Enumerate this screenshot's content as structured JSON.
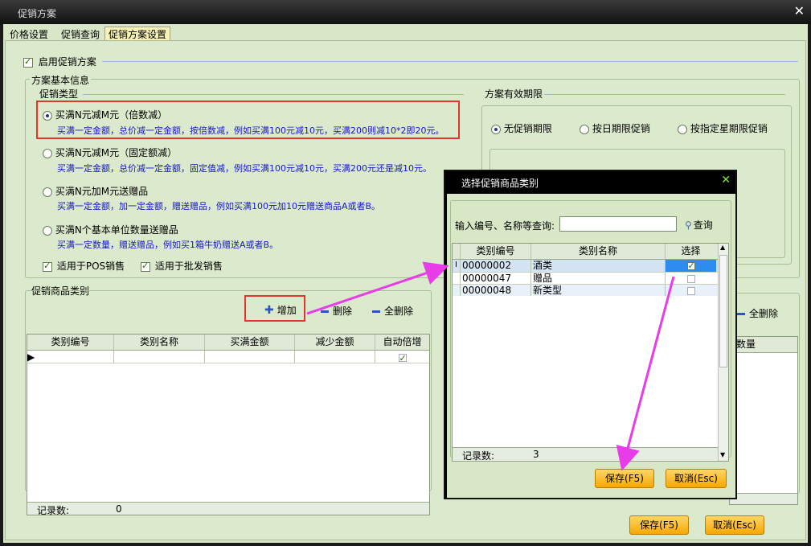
{
  "window": {
    "title": "促销方案",
    "close": "✕"
  },
  "tabs": [
    "价格设置",
    "促销查询",
    "促销方案设置"
  ],
  "enable_label": "启用促销方案",
  "basic_info": {
    "title": "方案基本信息",
    "type_title": "促销类型",
    "options": [
      {
        "label": "买满N元减M元（倍数减）",
        "desc": "买满一定金额，总价减一定金额，按倍数减，例如买满100元减10元，买满200则减10*2即20元。",
        "selected": true
      },
      {
        "label": "买满N元减M元（固定额减）",
        "desc": "买满一定金额，总价减一定金额，固定值减，例如买满100元减10元，买满200元还是减10元。",
        "selected": false
      },
      {
        "label": "买满N元加M元送赠品",
        "desc": "买满一定金额，加一定金额，赠送赠品，例如买满100元加10元赠送商品A或者B。",
        "selected": false
      },
      {
        "label": "买满N个基本单位数量送赠品",
        "desc": "买满一定数量，赠送赠品，例如买1箱牛奶赠送A或者B。",
        "selected": false
      }
    ],
    "pos_label": "适用于POS销售",
    "batch_label": "适用于批发销售"
  },
  "validity": {
    "title": "方案有效期限",
    "options": [
      "无促销期限",
      "按日期限促销",
      "按指定星期限促销"
    ],
    "selected_index": 0
  },
  "category": {
    "title": "促销商品类别",
    "add": "增加",
    "delete": "删除",
    "delete_all": "全删除",
    "columns": [
      "类别编号",
      "类别名称",
      "买满金额",
      "减少金额",
      "自动倍增"
    ],
    "footer_label": "记录数:",
    "footer_count": "0"
  },
  "right_panel": {
    "delete_all": "全删除",
    "column": "赠送数量"
  },
  "main_buttons": {
    "save": "保存(F5)",
    "cancel": "取消(Esc)"
  },
  "dialog": {
    "title": "选择促销商品类别",
    "close": "✕",
    "search_label": "输入编号、名称等查询:",
    "search_value": "",
    "search_button": "查询",
    "columns": [
      "类别编号",
      "类别名称",
      "选择"
    ],
    "rows": [
      {
        "code": "00000002",
        "name": "酒类",
        "checked": true
      },
      {
        "code": "00000047",
        "name": "赠品",
        "checked": false
      },
      {
        "code": "00000048",
        "name": "新类型",
        "checked": false
      }
    ],
    "footer_label": "记录数:",
    "footer_count": "3",
    "save": "保存(F5)",
    "cancel": "取消(Esc)"
  },
  "colors": {
    "accent": "#f6a800",
    "highlight": "#e0362c",
    "arrow": "#e83ce8"
  }
}
